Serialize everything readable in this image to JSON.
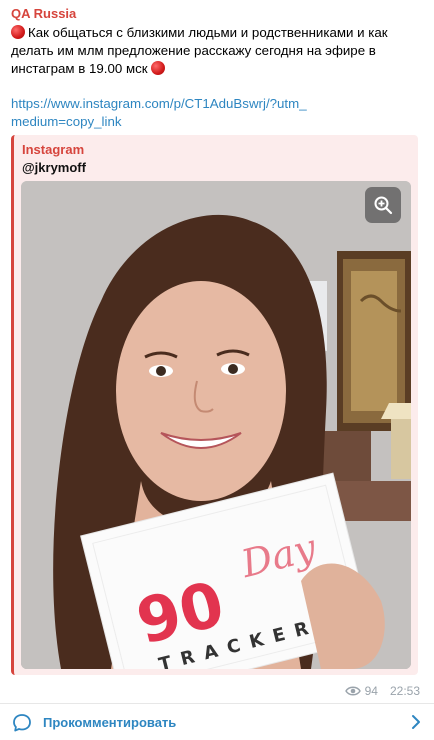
{
  "message": {
    "channel_name": "QA Russia",
    "text": "Как общаться с близкими людьми  и родственниками и как делать им млм предложение расскажу сегодня на эфире в инстаграм в 19.00 мск",
    "red_dot_icon": "red-circle-icon",
    "link": "https://www.instagram.com/p/CT1AduBswrj/?utm_medium=copy_link"
  },
  "preview": {
    "site_name": "Instagram",
    "handle": "@jkrymoff",
    "zoom_icon": "zoom-in-icon",
    "photo": {
      "card_number": "90",
      "card_word": "Day",
      "card_subtitle": "TRACKER"
    }
  },
  "meta": {
    "views": "94",
    "time": "22:53",
    "views_icon": "eye-icon"
  },
  "footer": {
    "comment_label": "Прокомментировать",
    "comment_icon": "comment-bubble-icon",
    "chevron_icon": "chevron-right-icon"
  },
  "colors": {
    "accent_red": "#d6453d",
    "link_blue": "#2e86c1",
    "preview_bg": "#fcecec"
  }
}
